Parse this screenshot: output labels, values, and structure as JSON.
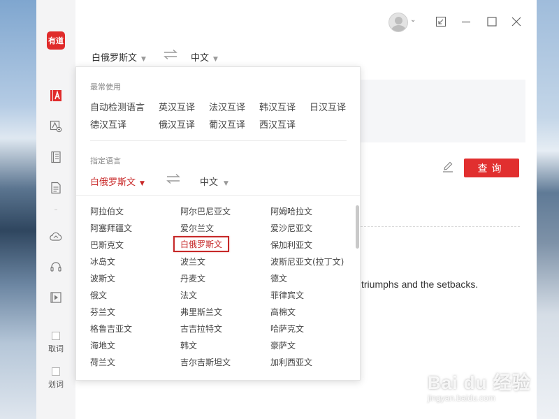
{
  "app": {
    "logo_text": "有道",
    "brand_color": "#e02b2b"
  },
  "sidebar": {
    "items": [
      {
        "icon": "translate-icon",
        "active": true
      },
      {
        "icon": "image-translate-icon"
      },
      {
        "icon": "dictionary-book-icon"
      },
      {
        "icon": "document-icon"
      },
      {
        "icon": "cloud-icon"
      },
      {
        "icon": "headset-icon"
      },
      {
        "icon": "video-play-icon"
      }
    ],
    "checks": [
      {
        "label": "取词"
      },
      {
        "label": "划词"
      }
    ]
  },
  "lang_bar": {
    "source": "白俄罗斯文",
    "target": "中文"
  },
  "dropdown": {
    "frequent_title": "最常使用",
    "frequent_items": [
      "自动检测语言",
      "英汉互译",
      "法汉互译",
      "韩汉互译",
      "日汉互译",
      "德汉互译",
      "俄汉互译",
      "葡汉互译",
      "西汉互译"
    ],
    "specified_title": "指定语言",
    "selected_source": "白俄罗斯文",
    "selected_target": "中文",
    "languages": [
      "阿拉伯文",
      "阿尔巴尼亚文",
      "阿姆哈拉文",
      "阿塞拜疆文",
      "爱尔兰文",
      "爱沙尼亚文",
      "巴斯克文",
      "白俄罗斯文",
      "保加利亚文",
      "冰岛文",
      "波兰文",
      "波斯尼亚文(拉丁文)",
      "波斯文",
      "丹麦文",
      "德文",
      "俄文",
      "法文",
      "菲律宾文",
      "芬兰文",
      "弗里斯兰文",
      "高棉文",
      "格鲁吉亚文",
      "古吉拉特文",
      "哈萨克文",
      "海地文",
      "韩文",
      "豪萨文",
      "荷兰文",
      "吉尔吉斯坦文",
      "加利西亚文"
    ],
    "highlighted": "白俄罗斯文"
  },
  "main": {
    "query_button": "查询",
    "result_snippet": "triumphs and the setbacks."
  },
  "watermark": {
    "main": "Bai du 经验",
    "sub": "jingyan.baidu.com"
  }
}
